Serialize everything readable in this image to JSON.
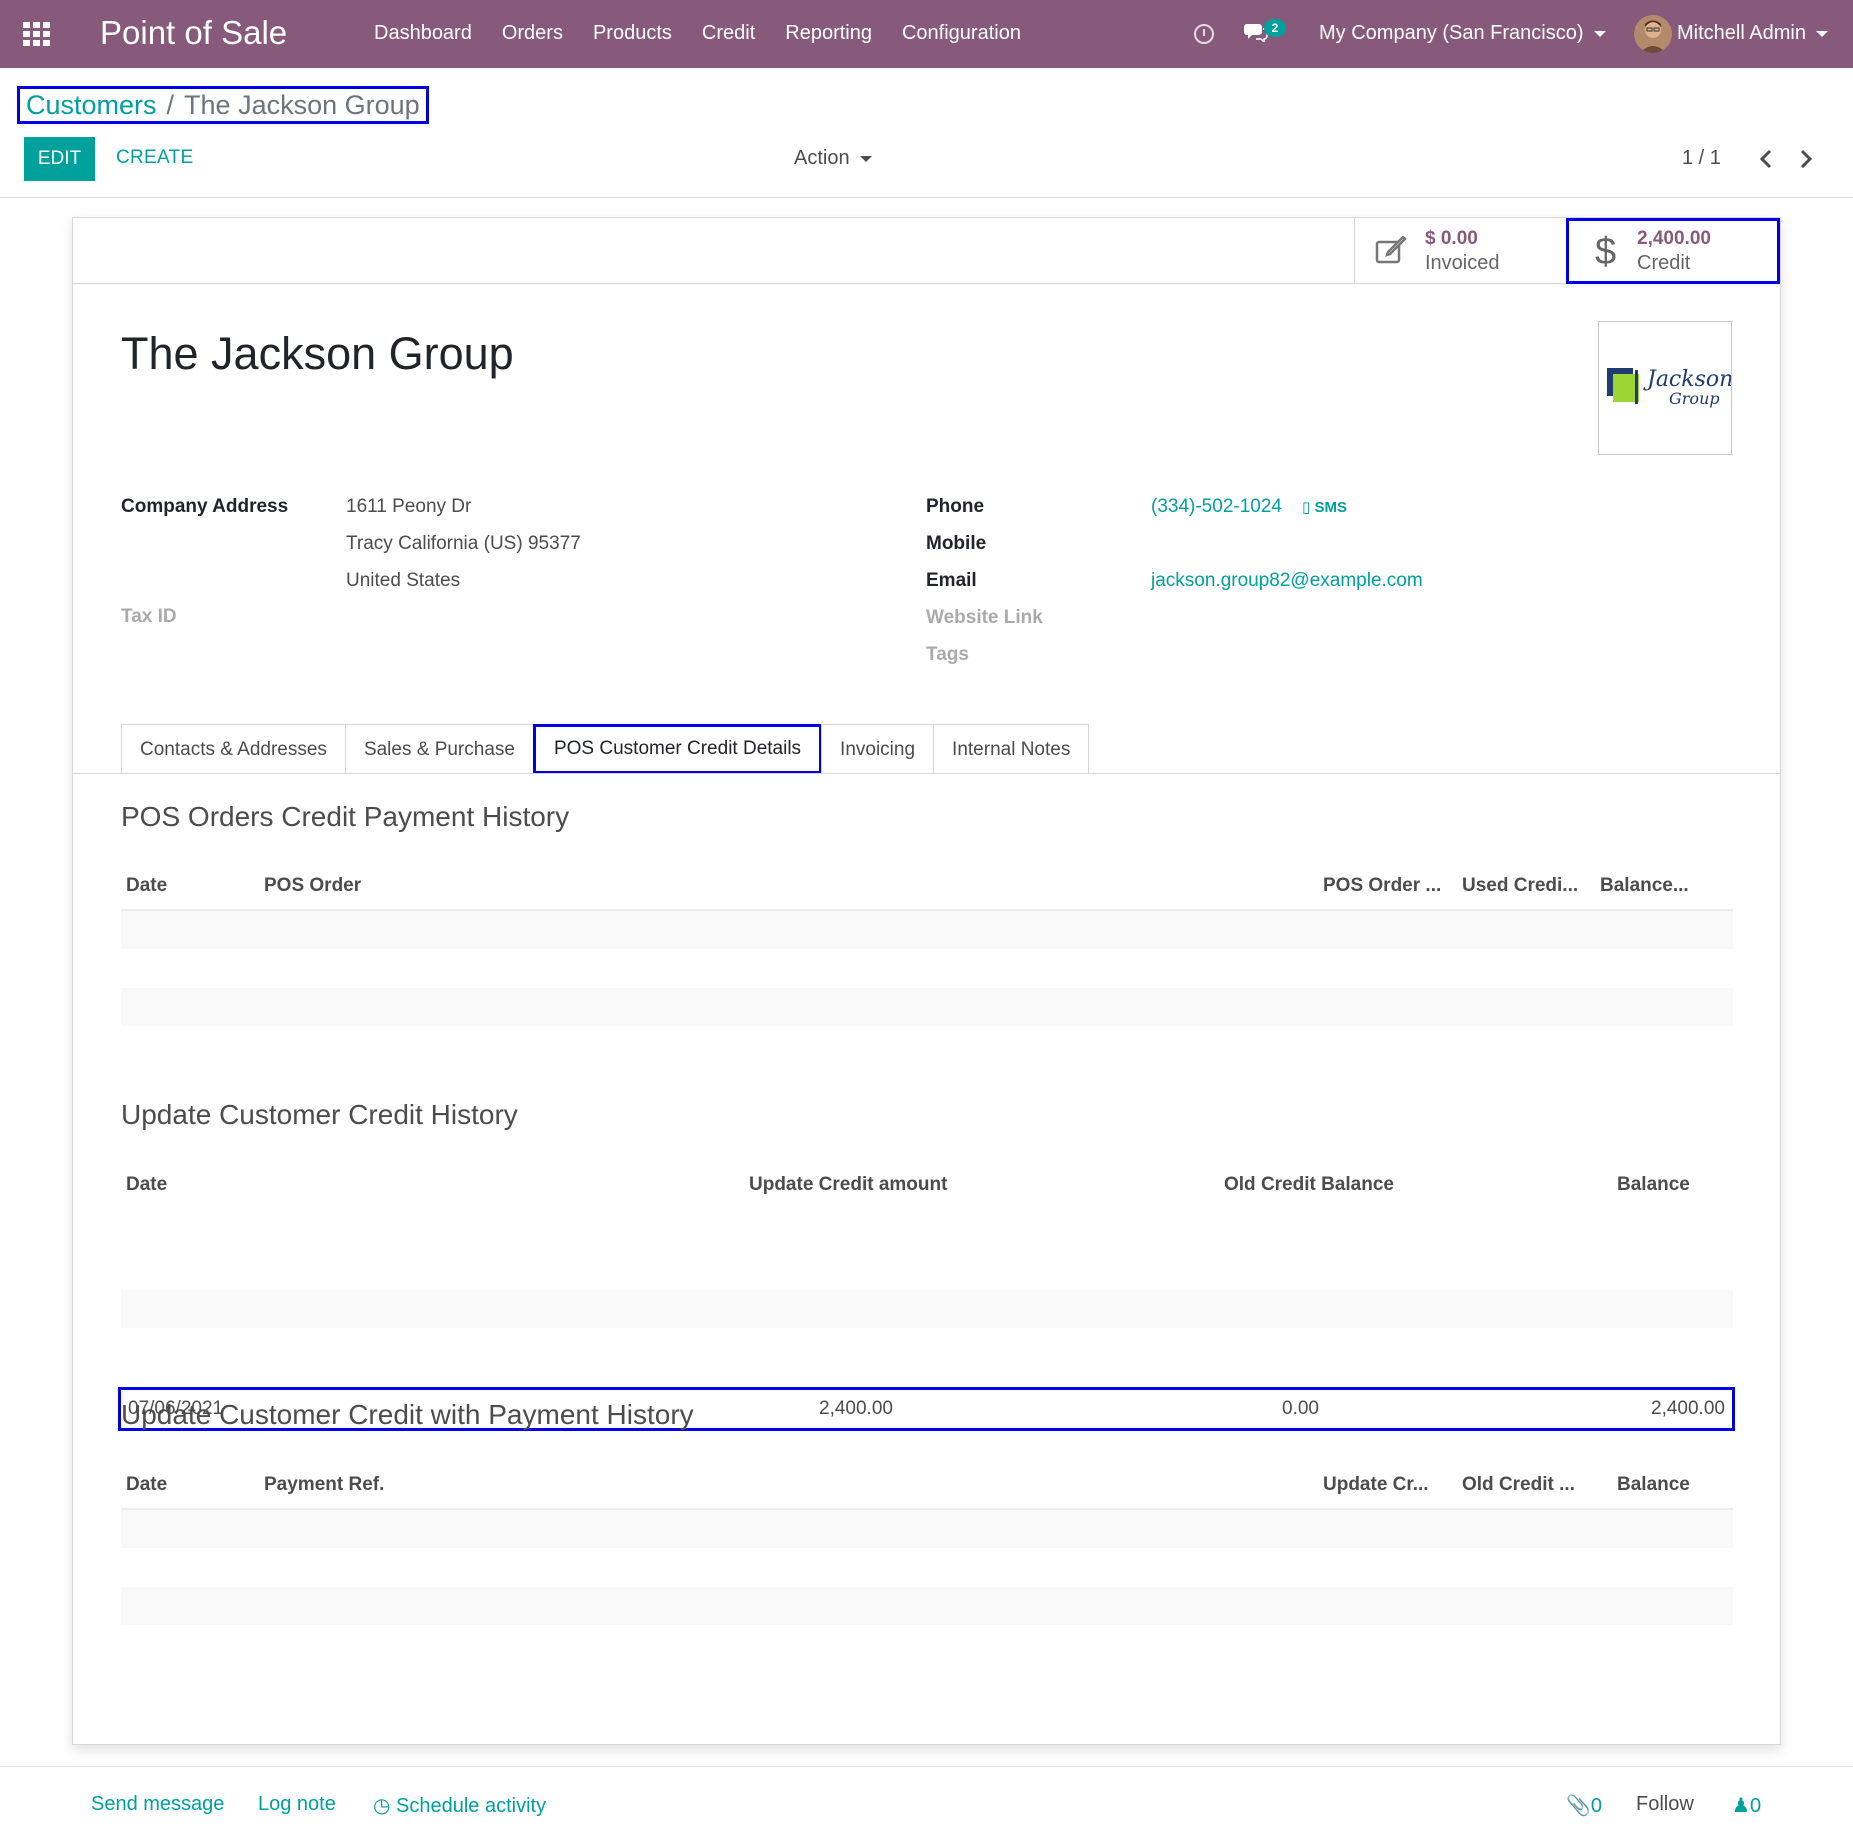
{
  "navbar": {
    "app_title": "Point of Sale",
    "menu": [
      "Dashboard",
      "Orders",
      "Products",
      "Credit",
      "Reporting",
      "Configuration"
    ],
    "chat_count": "2",
    "company": "My Company (San Francisco)",
    "user": "Mitchell Admin",
    "color": "#875a7b"
  },
  "breadcrumb": {
    "parent": "Customers",
    "separator": "/",
    "current": "The Jackson Group"
  },
  "control": {
    "edit_label": "EDIT",
    "create_label": "CREATE",
    "action_label": "Action",
    "pager": "1 / 1"
  },
  "stats": {
    "invoiced_value": "$ 0.00",
    "invoiced_label": "Invoiced",
    "credit_value": "2,400.00",
    "credit_label": "Credit"
  },
  "partner": {
    "name": "The Jackson Group",
    "logo_text_1": "Jackson",
    "logo_text_2": "Group"
  },
  "fields": {
    "company_address_label": "Company Address",
    "street": "1611 Peony Dr",
    "city_line": "Tracy  California (US)  95377",
    "country": "United States",
    "tax_id_label": "Tax ID",
    "phone_label": "Phone",
    "phone": "(334)-502-1024",
    "sms_label": "SMS",
    "mobile_label": "Mobile",
    "email_label": "Email",
    "email": "jackson.group82@example.com",
    "website_label": "Website Link",
    "tags_label": "Tags"
  },
  "tabs": [
    "Contacts & Addresses",
    "Sales & Purchase",
    "POS Customer Credit Details",
    "Invoicing",
    "Internal Notes"
  ],
  "pos_history": {
    "title": "POS Orders Credit Payment History",
    "columns": [
      "Date",
      "POS Order",
      "POS Order ...",
      "Used Credi...",
      "Balance..."
    ]
  },
  "update_history": {
    "title": "Update Customer Credit History",
    "columns": [
      "Date",
      "Update Credit amount",
      "Old Credit Balance",
      "Balance"
    ],
    "rows": [
      {
        "date": "07/06/2021",
        "update_amount": "2,400.00",
        "old_balance": "0.00",
        "balance": "2,400.00"
      }
    ]
  },
  "payment_history": {
    "title": "Update Customer Credit with Payment History",
    "columns": [
      "Date",
      "Payment Ref.",
      "Update Cr...",
      "Old Credit ...",
      "Balance"
    ]
  },
  "chatter": {
    "send_message": "Send message",
    "log_note": "Log note",
    "schedule_activity": "Schedule activity",
    "attachments": "0",
    "follow": "Follow",
    "followers": "0"
  }
}
